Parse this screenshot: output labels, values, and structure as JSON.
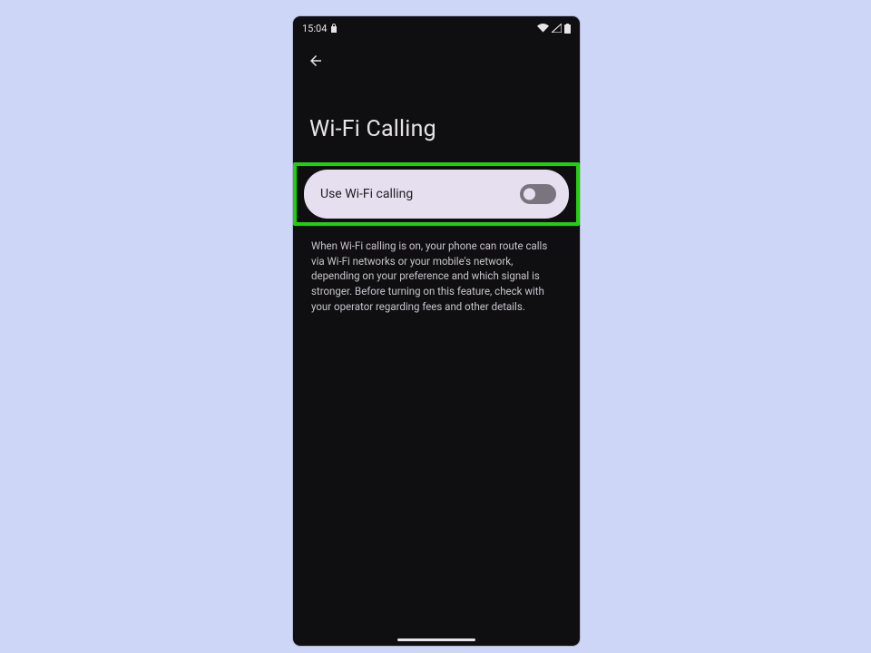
{
  "status": {
    "time": "15:04"
  },
  "header": {
    "title": "Wi-Fi Calling"
  },
  "setting": {
    "label": "Use Wi-Fi calling",
    "enabled": false
  },
  "description": {
    "text": "When Wi-Fi calling is on, your phone can route calls via Wi-Fi networks or your mobile's network, depending on your preference and which signal is stronger. Before turning on this feature, check with your operator regarding fees and other details."
  }
}
